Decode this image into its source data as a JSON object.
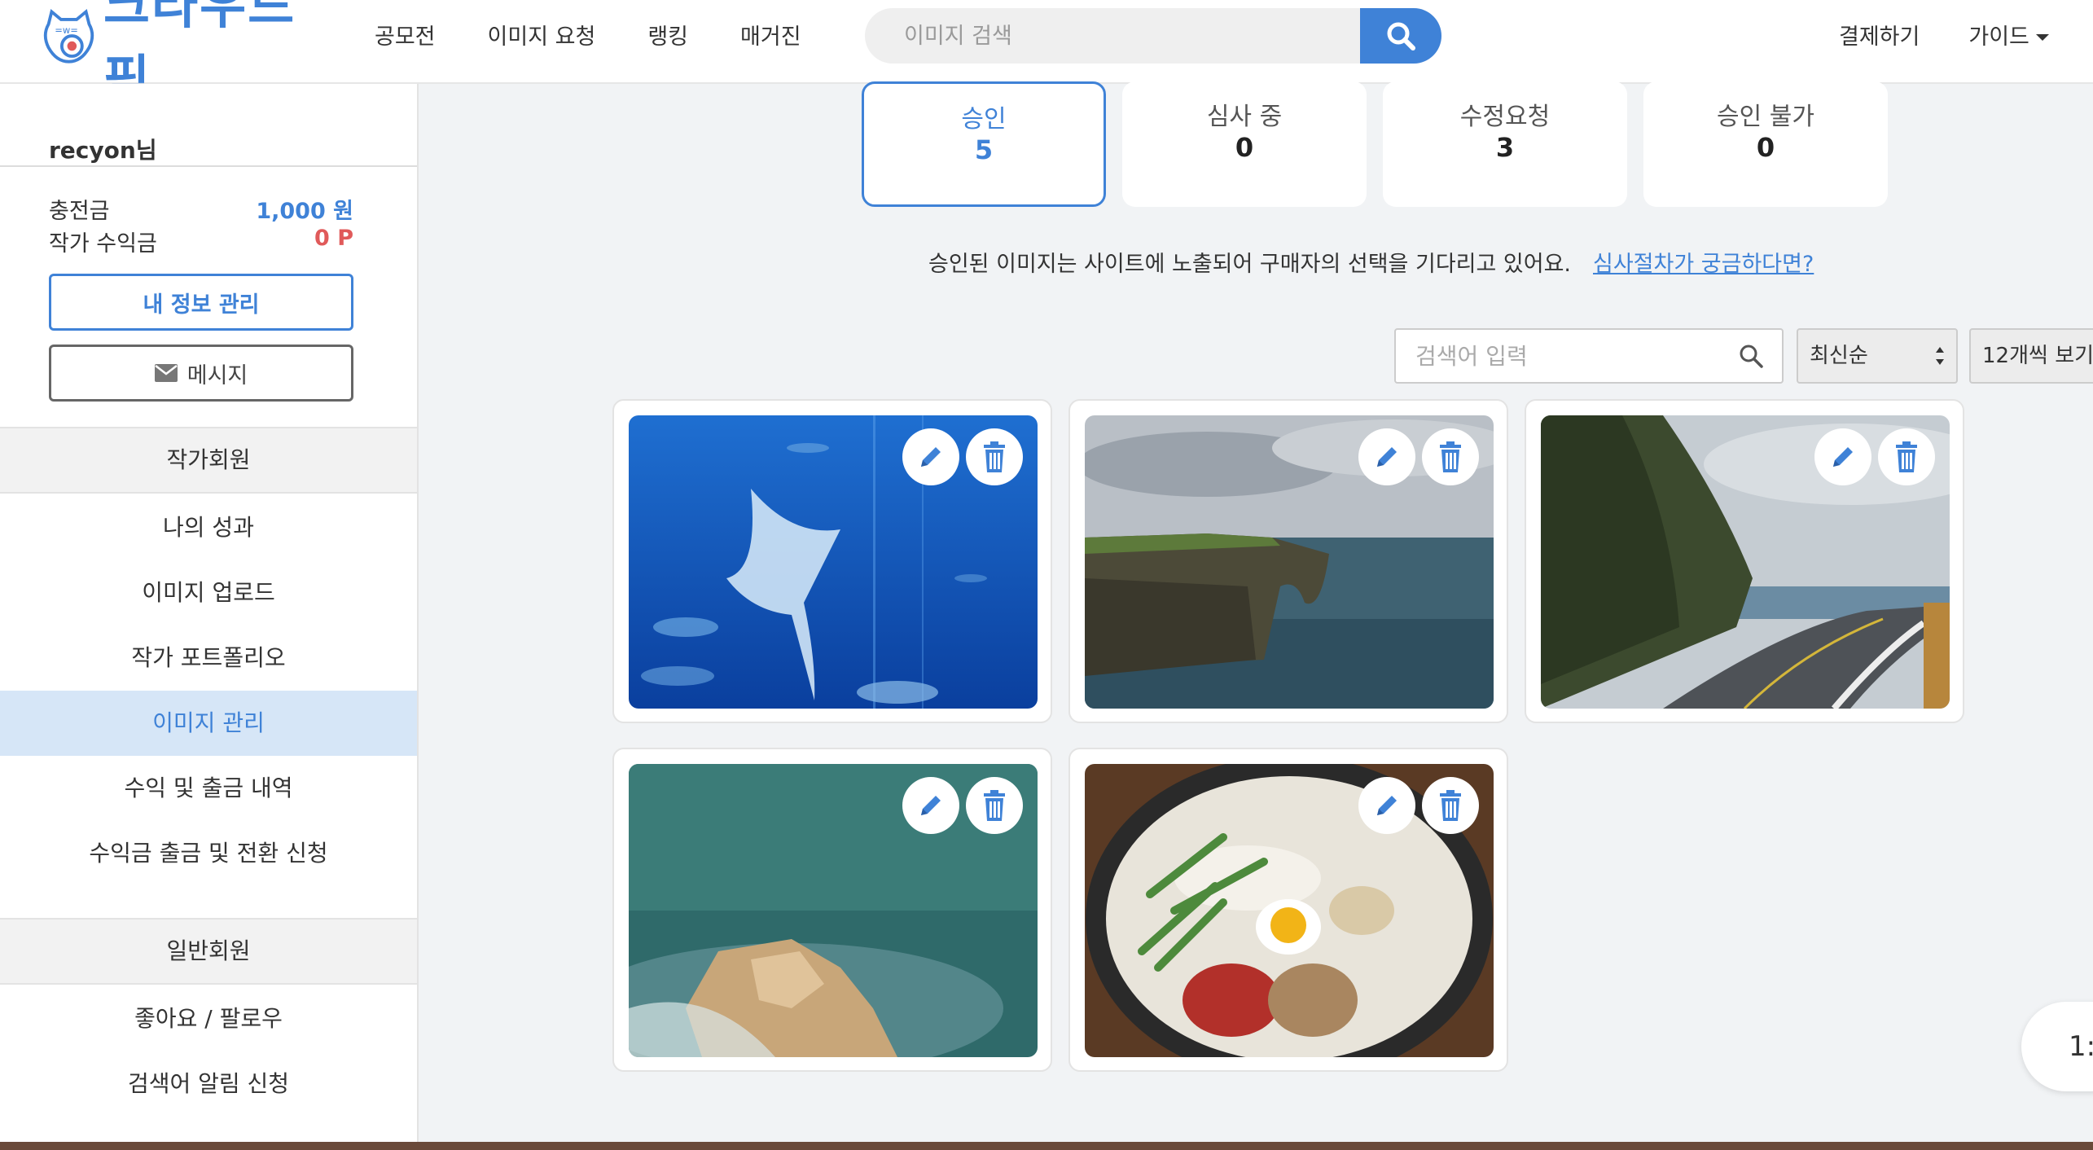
{
  "header": {
    "logo_text": "크라우드픽",
    "nav": [
      "공모전",
      "이미지 요청",
      "랭킹",
      "매거진"
    ],
    "search_placeholder": "이미지 검색",
    "checkout": "결제하기",
    "guide": "가이드"
  },
  "sidebar": {
    "user_name": "recyon님",
    "balance_label": "충전금",
    "balance_value": "1,000 원",
    "earnings_label": "작가 수익금",
    "earnings_value": "0 P",
    "profile_button": "내 정보 관리",
    "message_button": "메시지",
    "section_artist": "작가회원",
    "artist_menu": [
      "나의 성과",
      "이미지 업로드",
      "작가 포트폴리오",
      "이미지 관리",
      "수익 및 출금 내역",
      "수익금 출금 및 전환 신청"
    ],
    "active_item": "이미지 관리",
    "section_general": "일반회원",
    "general_menu": [
      "좋아요 / 팔로우",
      "검색어 알림 신청"
    ]
  },
  "tabs": [
    {
      "label": "승인",
      "count": "5",
      "active": true
    },
    {
      "label": "심사 중",
      "count": "0",
      "active": false
    },
    {
      "label": "수정요청",
      "count": "3",
      "active": false
    },
    {
      "label": "승인 불가",
      "count": "0",
      "active": false
    }
  ],
  "notice": {
    "text": "승인된 이미지는 사이트에 노출되어 구매자의 선택을 기다리고 있어요.",
    "link": "심사절차가 궁금하다면?"
  },
  "filters": {
    "search_placeholder": "검색어 입력",
    "sort_value": "최신순",
    "count_value": "12개씩 보기"
  },
  "images": [
    {
      "subject": "manta-ray-aquarium"
    },
    {
      "subject": "sea-cliff-arch"
    },
    {
      "subject": "coastal-road"
    },
    {
      "subject": "sea-rocks"
    },
    {
      "subject": "stone-pot-noodle-soup"
    }
  ],
  "floating_button": "1:",
  "colors": {
    "accent": "#3f82d7",
    "red": "#e05a5a",
    "active_bg": "#d6e6f7"
  }
}
